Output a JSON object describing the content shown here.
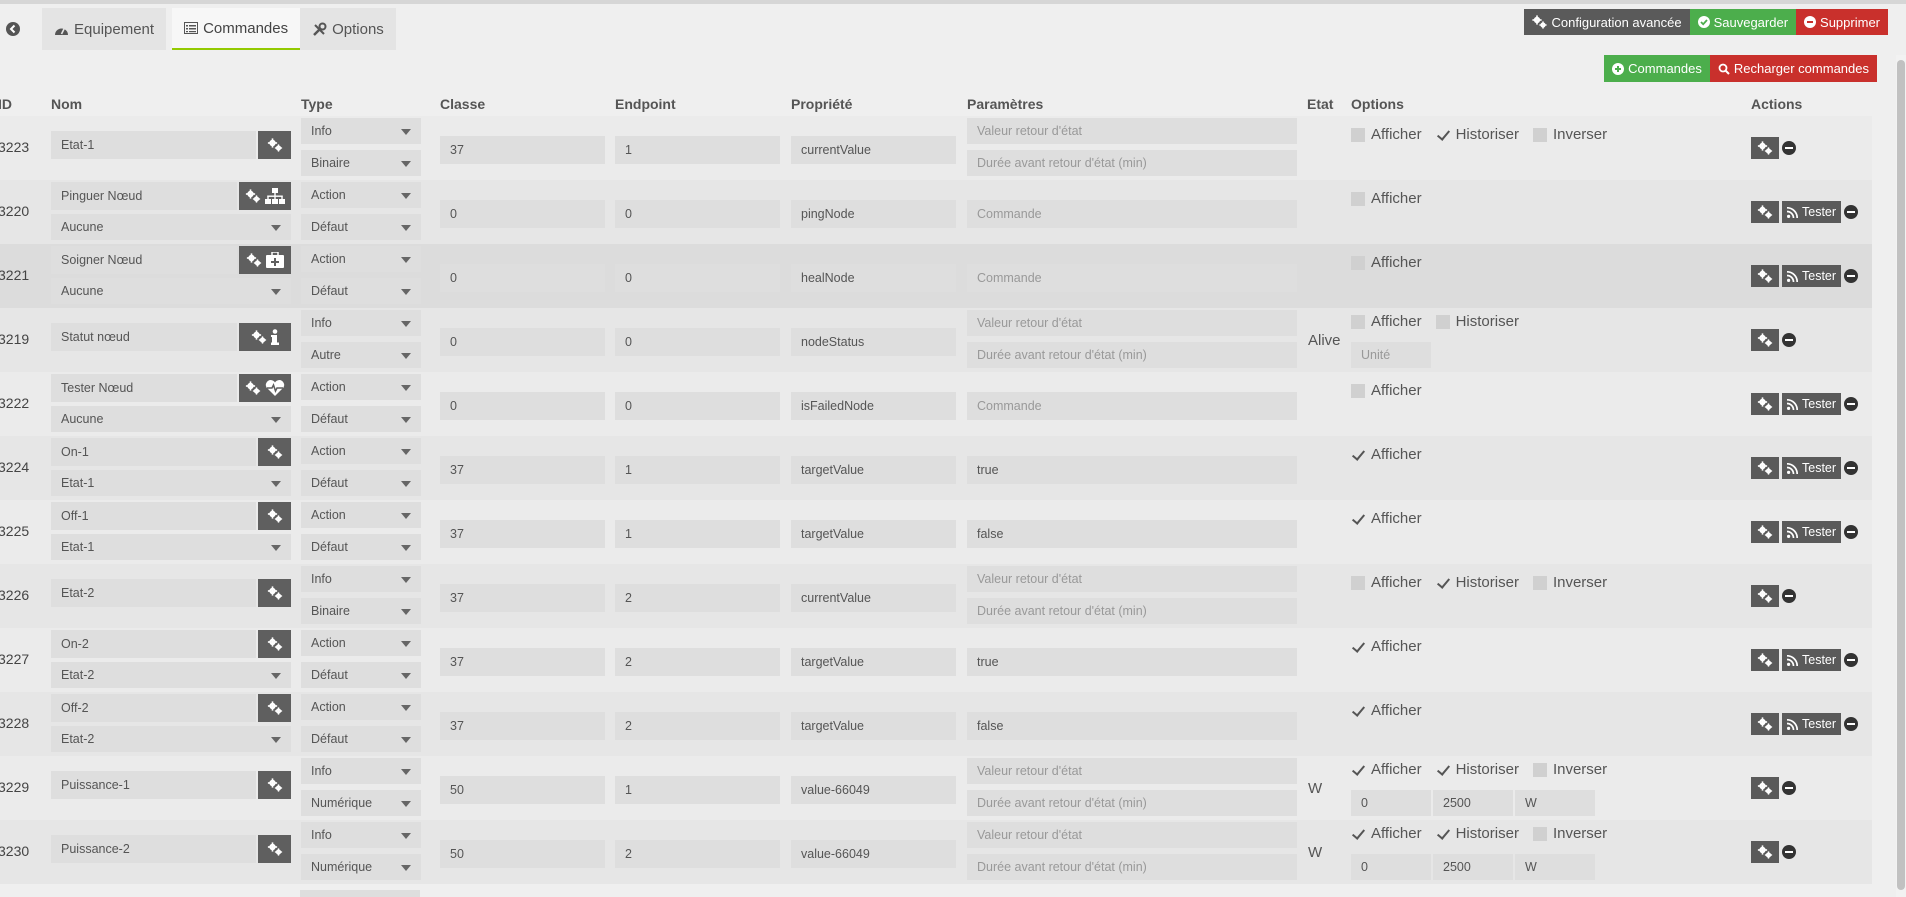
{
  "tabs": [
    {
      "label": "Equipement",
      "icon": "dashboard-icon"
    },
    {
      "label": "Commandes",
      "icon": "list-icon"
    },
    {
      "label": "Options",
      "icon": "wrench-icon"
    }
  ],
  "toolbar": {
    "config_label": "Configuration avancée",
    "save_label": "Sauvegarder",
    "delete_label": "Supprimer",
    "commands_label": "Commandes",
    "reload_label": "Recharger commandes"
  },
  "colors": {
    "accent_green": "#4cae4c",
    "danger_red": "#c9302c",
    "dark_button": "#5a5a5a",
    "active_tab_underline": "#94ca02"
  },
  "headers": {
    "id": "ID",
    "nom": "Nom",
    "type": "Type",
    "classe": "Classe",
    "endpoint": "Endpoint",
    "propriete": "Propriété",
    "parametres": "Paramètres",
    "etat": "Etat",
    "options": "Options",
    "actions": "Actions"
  },
  "labels": {
    "afficher": "Afficher",
    "historiser": "Historiser",
    "inverser": "Inverser",
    "tester": "Tester",
    "ph_valeur_retour": "Valeur retour d'état",
    "ph_duree": "Durée avant retour d'état (min)",
    "ph_commande": "Commande",
    "ph_unite": "Unité"
  },
  "rows": [
    {
      "id": "3223",
      "name": "Etat-1",
      "type": "Info",
      "subtype": "Binaire",
      "classe": "37",
      "endpoint": "1",
      "prop": "currentValue",
      "etat": ""
    },
    {
      "id": "3220",
      "name": "Pinguer Nœud",
      "link": "Aucune",
      "type": "Action",
      "subtype": "Défaut",
      "classe": "0",
      "endpoint": "0",
      "prop": "pingNode",
      "etat": ""
    },
    {
      "id": "3221",
      "name": "Soigner Nœud",
      "link": "Aucune",
      "type": "Action",
      "subtype": "Défaut",
      "classe": "0",
      "endpoint": "0",
      "prop": "healNode",
      "etat": ""
    },
    {
      "id": "3219",
      "name": "Statut nœud",
      "type": "Info",
      "subtype": "Autre",
      "classe": "0",
      "endpoint": "0",
      "prop": "nodeStatus",
      "etat": "Alive"
    },
    {
      "id": "3222",
      "name": "Tester Nœud",
      "link": "Aucune",
      "type": "Action",
      "subtype": "Défaut",
      "classe": "0",
      "endpoint": "0",
      "prop": "isFailedNode",
      "etat": ""
    },
    {
      "id": "3224",
      "name": "On-1",
      "link": "Etat-1",
      "type": "Action",
      "subtype": "Défaut",
      "classe": "37",
      "endpoint": "1",
      "prop": "targetValue",
      "param": "true",
      "etat": ""
    },
    {
      "id": "3225",
      "name": "Off-1",
      "link": "Etat-1",
      "type": "Action",
      "subtype": "Défaut",
      "classe": "37",
      "endpoint": "1",
      "prop": "targetValue",
      "param": "false",
      "etat": ""
    },
    {
      "id": "3226",
      "name": "Etat-2",
      "type": "Info",
      "subtype": "Binaire",
      "classe": "37",
      "endpoint": "2",
      "prop": "currentValue",
      "etat": ""
    },
    {
      "id": "3227",
      "name": "On-2",
      "link": "Etat-2",
      "type": "Action",
      "subtype": "Défaut",
      "classe": "37",
      "endpoint": "2",
      "prop": "targetValue",
      "param": "true",
      "etat": ""
    },
    {
      "id": "3228",
      "name": "Off-2",
      "link": "Etat-2",
      "type": "Action",
      "subtype": "Défaut",
      "classe": "37",
      "endpoint": "2",
      "prop": "targetValue",
      "param": "false",
      "etat": ""
    },
    {
      "id": "3229",
      "name": "Puissance-1",
      "type": "Info",
      "subtype": "Numérique",
      "classe": "50",
      "endpoint": "1",
      "prop": "value-66049",
      "etat": "W",
      "min": "0",
      "max": "2500",
      "unit": "W"
    },
    {
      "id": "3230",
      "name": "Puissance-2",
      "type": "Info",
      "subtype": "Numérique",
      "classe": "50",
      "endpoint": "2",
      "prop": "value-66049",
      "etat": "W",
      "min": "0",
      "max": "2500",
      "unit": "W"
    }
  ]
}
